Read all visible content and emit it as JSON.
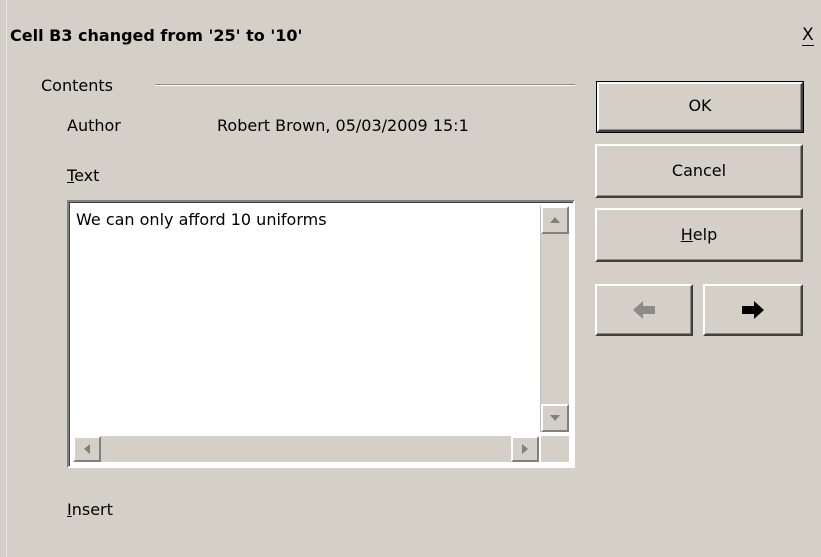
{
  "dialog": {
    "title": "Cell B3 changed from '25' to '10'",
    "close_label": "X"
  },
  "contents": {
    "group_label": "Contents",
    "author_label": "Author",
    "author_value": "Robert Brown, 05/03/2009 15:1",
    "text_label_first": "T",
    "text_label_rest": "ext",
    "text_value": "We can only afford 10 uniforms",
    "insert_label_first": "I",
    "insert_label_rest": "nsert"
  },
  "buttons": {
    "ok": "OK",
    "cancel": "Cancel",
    "help_first": "H",
    "help_rest": "elp"
  },
  "icons": {
    "prev": "arrow-left-icon",
    "next": "arrow-right-icon",
    "scroll_up": "scroll-up-icon",
    "scroll_down": "scroll-down-icon",
    "scroll_left": "scroll-left-icon",
    "scroll_right": "scroll-right-icon"
  }
}
